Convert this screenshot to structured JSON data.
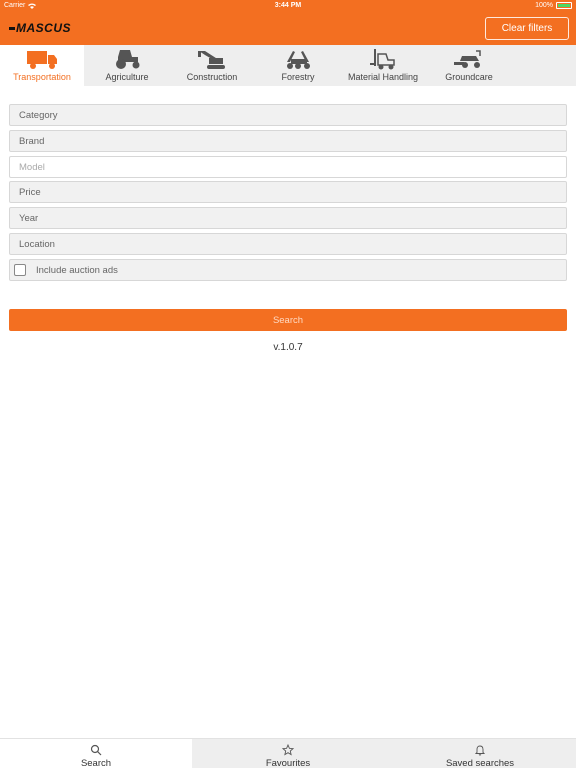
{
  "status_bar": {
    "carrier": "Carrier",
    "time": "3:44 PM",
    "battery": "100%"
  },
  "header": {
    "logo": "MASCUS",
    "clear_filters_label": "Clear filters",
    "accent_color": "#f36f21"
  },
  "categories": [
    {
      "label": "Transportation",
      "icon": "truck-icon",
      "active": true
    },
    {
      "label": "Agriculture",
      "icon": "tractor-icon",
      "active": false
    },
    {
      "label": "Construction",
      "icon": "excavator-icon",
      "active": false
    },
    {
      "label": "Forestry",
      "icon": "forestry-machine-icon",
      "active": false
    },
    {
      "label": "Material Handling",
      "icon": "forklift-icon",
      "active": false
    },
    {
      "label": "Groundcare",
      "icon": "mower-icon",
      "active": false
    }
  ],
  "filters": {
    "category": "Category",
    "brand": "Brand",
    "model_placeholder": "Model",
    "price": "Price",
    "year": "Year",
    "location": "Location",
    "include_auction": "Include auction ads"
  },
  "search_label": "Search",
  "version": "v.1.0.7",
  "bottom_tabs": [
    {
      "label": "Search",
      "icon": "search-icon",
      "active": true
    },
    {
      "label": "Favourites",
      "icon": "star-icon",
      "active": false
    },
    {
      "label": "Saved searches",
      "icon": "bell-icon",
      "active": false
    }
  ]
}
